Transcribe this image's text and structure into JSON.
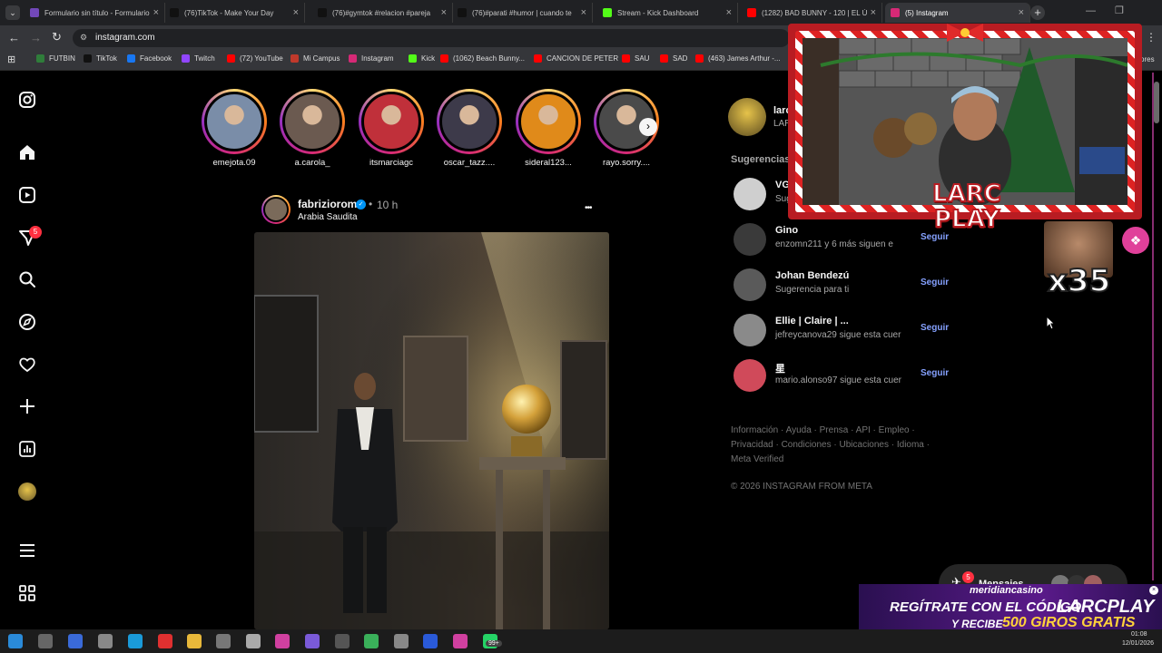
{
  "browser": {
    "tabs": [
      {
        "title": "Formulario sin título - Formulario",
        "color": "#7248b9"
      },
      {
        "title": "(76)TikTok - Make Your Day",
        "color": "#111111"
      },
      {
        "title": "(76)#gymtok #relacion #pareja",
        "color": "#111111"
      },
      {
        "title": "(76)#parati #humor | cuando te",
        "color": "#111111"
      },
      {
        "title": "Stream - Kick Dashboard",
        "color": "#53fc18"
      },
      {
        "title": "(1282) BAD BUNNY - 120 | EL Ú",
        "color": "#ff0000"
      },
      {
        "title": "(5) Instagram",
        "color": "#d62976"
      }
    ],
    "url": "instagram.com",
    "bookmarks": [
      {
        "label": "FUTBIN",
        "color": "#2f7d3a"
      },
      {
        "label": "TikTok",
        "color": "#111111"
      },
      {
        "label": "Facebook",
        "color": "#1877f2"
      },
      {
        "label": "Twitch",
        "color": "#9146ff"
      },
      {
        "label": "(72) YouTube",
        "color": "#ff0000"
      },
      {
        "label": "Mi Campus",
        "color": "#c0392b"
      },
      {
        "label": "Instagram",
        "color": "#d62976"
      },
      {
        "label": "Kick",
        "color": "#53fc18"
      },
      {
        "label": "(1062) Beach Bunny...",
        "color": "#ff0000"
      },
      {
        "label": "CANCION DE PETER",
        "color": "#ff0000"
      },
      {
        "label": "SAU",
        "color": "#ff0000"
      },
      {
        "label": "SAD",
        "color": "#ff0000"
      },
      {
        "label": "(463) James Arthur -...",
        "color": "#ff0000"
      }
    ],
    "bookmarks_more": "ores"
  },
  "instagram": {
    "notification_count": "5",
    "stories": [
      {
        "name": "emejota.09",
        "color": "#7a8da8"
      },
      {
        "name": "a.carola_",
        "color": "#6b5a50"
      },
      {
        "name": "itsmarciagc",
        "color": "#c0303a"
      },
      {
        "name": "oscar_tazz....",
        "color": "#3d3a4a"
      },
      {
        "name": "sideral123...",
        "color": "#e08a1a"
      },
      {
        "name": "rayo.sorry....",
        "color": "#4a4a4a"
      }
    ],
    "post": {
      "username": "fabriziorom",
      "time": "10 h",
      "location": "Arabia Saudita",
      "more": "•••"
    },
    "account": {
      "username": "larcp",
      "fullname": "LARC"
    },
    "suggestions_title": "Sugerencias p",
    "suggestions": [
      {
        "username": "VG",
        "subtitle": "Sug",
        "follow": "",
        "color": "#cfcfcf"
      },
      {
        "username": "Gino",
        "subtitle": "enzomn211 y 6 más siguen e",
        "follow": "Seguir",
        "color": "#3a3a3a"
      },
      {
        "username": "Johan Bendezú",
        "subtitle": "Sugerencia para ti",
        "follow": "Seguir",
        "color": "#5a5a5a"
      },
      {
        "username": "Ellie | Claire | ...",
        "subtitle": "jefreycanova29 sigue esta cuer",
        "follow": "Seguir",
        "color": "#8a8a8a"
      },
      {
        "username": "星",
        "subtitle": "mario.alonso97 sigue esta cuer",
        "follow": "Seguir",
        "color": "#d04a5a"
      }
    ],
    "footer_lines": [
      "Información · Ayuda · Prensa · API · Empleo ·",
      "Privacidad · Condiciones · Ubicaciones · Idioma ·",
      "Meta Verified"
    ],
    "copyright": "© 2026 INSTAGRAM FROM META",
    "messages_label": "Mensajes",
    "messages_badge": "5"
  },
  "overlay": {
    "logo_line1": "LARC",
    "logo_line2": "PLAY",
    "multiplier": "x35",
    "casino_name": "meridiancasino",
    "promo_line1": "REGÍTRATE CON EL CÓDIGO",
    "promo_code": "LARCPLAY",
    "promo_line2a": "Y RECIBE",
    "promo_line2b": "500 GIROS GRATIS"
  },
  "taskbar": {
    "badge": "99+",
    "time": "01:08",
    "date": "12/01/2026"
  }
}
